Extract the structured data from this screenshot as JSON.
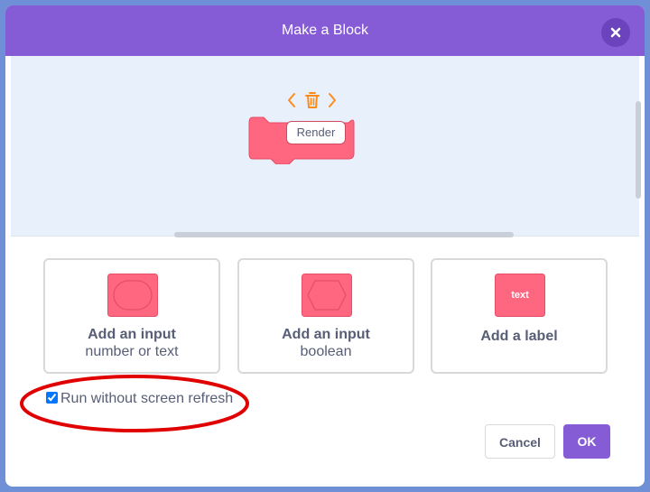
{
  "dialog": {
    "title": "Make a Block",
    "close_icon": "close-icon"
  },
  "block": {
    "name": "Render",
    "tools": {
      "left_icon": "chevron-left-icon",
      "delete_icon": "trash-icon",
      "right_icon": "chevron-right-icon"
    },
    "color": "#ff6680"
  },
  "options": [
    {
      "title": "Add an input",
      "subtitle": "number or text",
      "icon": "rounded-input-shape"
    },
    {
      "title": "Add an input",
      "subtitle": "boolean",
      "icon": "boolean-input-shape"
    },
    {
      "title": "Add a label",
      "subtitle": "",
      "icon": "label-shape",
      "icon_text": "text"
    }
  ],
  "run_without_refresh": {
    "label": "Run without screen refresh",
    "checked": true
  },
  "buttons": {
    "cancel": "Cancel",
    "ok": "OK"
  },
  "colors": {
    "header": "#855cd6",
    "block": "#ff6680",
    "accent_orange": "#ff8c1a",
    "annotation": "#e00000"
  }
}
